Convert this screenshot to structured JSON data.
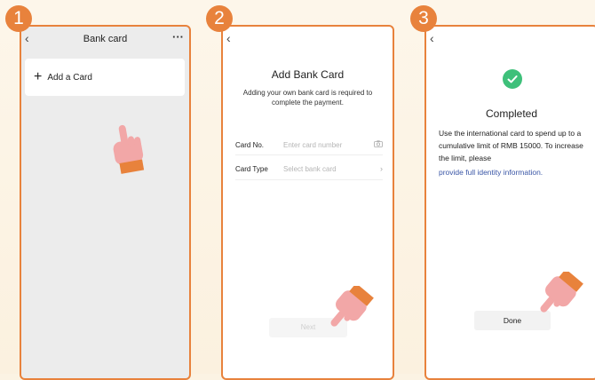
{
  "steps": [
    "1",
    "2",
    "3"
  ],
  "screen1": {
    "title": "Bank card",
    "more_label": "···",
    "back_icon": "‹",
    "add_card_label": "Add a Card",
    "add_icon": "+"
  },
  "screen2": {
    "back_icon": "‹",
    "title": "Add Bank Card",
    "subtitle": "Adding your own bank card is required to complete the payment.",
    "card_no_label": "Card No.",
    "card_no_placeholder": "Enter card number",
    "card_type_label": "Card Type",
    "card_type_placeholder": "Select bank card",
    "next_label": "Next"
  },
  "screen3": {
    "back_icon": "‹",
    "title": "Completed",
    "body": "Use the international card to spend up to a cumulative limit of RMB 15000. To increase the limit, please",
    "link": "provide full identity information.",
    "done_label": "Done"
  },
  "colors": {
    "accent": "#e8823c",
    "success": "#3ec07a",
    "link": "#3a56a6",
    "hand": "#f2a7a7"
  },
  "icons": {
    "camera": "camera-icon",
    "chevron": "chevron-right-icon",
    "check": "check-circle-icon",
    "pointer": "pointing-hand-icon"
  }
}
